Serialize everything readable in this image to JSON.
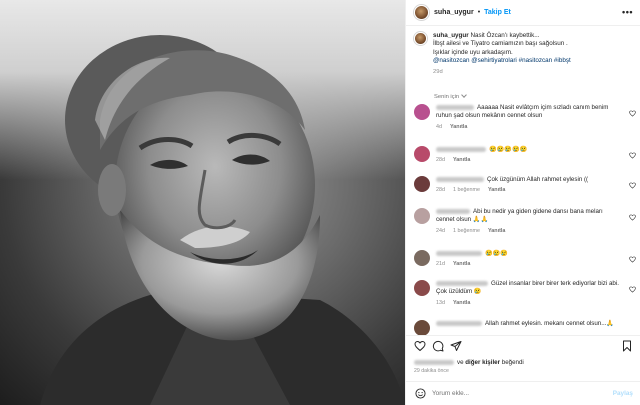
{
  "post": {
    "username": "suha_uygur",
    "separator": "•",
    "follow_label": "Takip Et",
    "more_icon": "•••"
  },
  "caption": {
    "username": "suha_uygur",
    "line1": "Nasit Özcan'ı kaybettik...",
    "line2": "İlbşt ailesi ve Tiyatro camiamızın başı sağolsun .",
    "line3": "Işıklar içinde uyu arkadaşım.",
    "tags": "@nasitozcan @sehirtiyatrolari #nasitozcan #ibbşt",
    "time": "29d"
  },
  "filter": {
    "label": "Senin için"
  },
  "comments": [
    {
      "text": "Aaaaaa Nasit evlâtçım içim sızladı canım benim ruhun şad olsun mekânın cennet olsun",
      "time": "4d",
      "likes": "",
      "reply": "Yanıtla",
      "avatar_color": "#b8508f"
    },
    {
      "text": "😢😢😢😢😢",
      "time": "28d",
      "likes": "",
      "reply": "Yanıtla",
      "avatar_color": "#b84a6a"
    },
    {
      "text": "Çok üzgünüm Allah rahmet eylesin ((",
      "time": "28d",
      "likes": "1 beğenme",
      "reply": "Yanıtla",
      "avatar_color": "#6b3b3b"
    },
    {
      "text": "Abi bu nedir ya giden gidene dansı bana meları cennet olsun 🙏🙏",
      "time": "24d",
      "likes": "1 beğenme",
      "reply": "Yanıtla",
      "avatar_color": "#b8a0a0"
    },
    {
      "text": "😢😢😢",
      "time": "21d",
      "likes": "",
      "reply": "Yanıtla",
      "avatar_color": "#7a6a60"
    },
    {
      "text": "Güzel insanlar birer birer terk ediyorlar bizi abi. Çok üzüldüm 😢",
      "time": "13d",
      "likes": "",
      "reply": "Yanıtla",
      "avatar_color": "#8a4a4a"
    },
    {
      "text": "Allah rahmet eylesin. mekanı cennet olsun...🙏",
      "time": "",
      "likes": "",
      "reply": "",
      "avatar_color": "#6a4a3a"
    }
  ],
  "likes_line": {
    "middle": "ve",
    "bold": "diğer kişiler",
    "suffix": "beğendi"
  },
  "timestamp": "29 dakika önce",
  "composer": {
    "placeholder": "Yorum ekle...",
    "post_label": "Paylaş"
  },
  "icons": [
    "heart-icon",
    "comment-icon",
    "share-icon",
    "bookmark-icon",
    "emoji-icon"
  ]
}
